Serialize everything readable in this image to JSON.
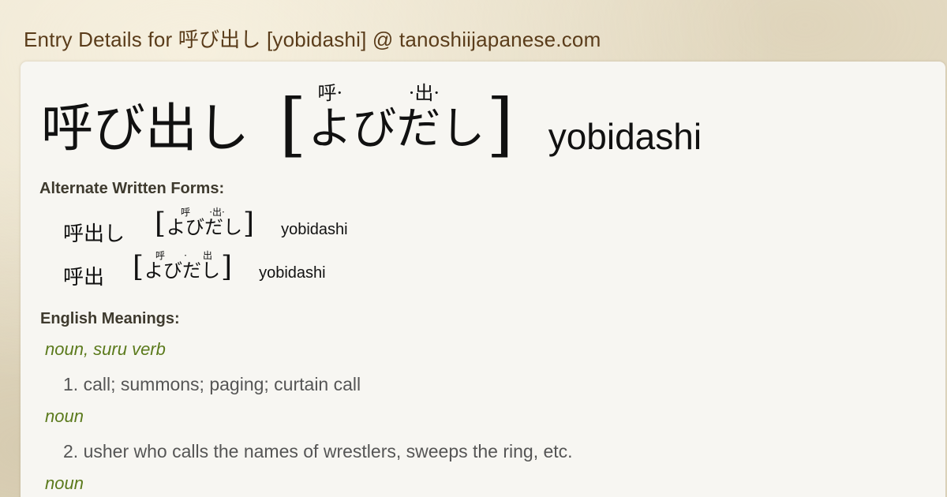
{
  "header": {
    "title": "Entry Details for 呼び出し [yobidashi] @ tanoshiijapanese.com"
  },
  "entry": {
    "kanji": "呼び出し",
    "bracket_open": "[",
    "bracket_close": "]",
    "ruby_top": [
      "呼·",
      "",
      "·出·",
      ""
    ],
    "reading": "よびだし",
    "romaji": "yobidashi"
  },
  "alternate_forms": {
    "heading": "Alternate Written Forms:",
    "items": [
      {
        "kanji": "呼出し",
        "ruby_top": [
          "呼",
          "·出·",
          ""
        ],
        "reading": "よびだし",
        "romaji": "yobidashi"
      },
      {
        "kanji": "呼出",
        "ruby_top": [
          "呼",
          "·",
          "出"
        ],
        "reading": "よびだし",
        "romaji": "yobidashi"
      }
    ]
  },
  "meanings": {
    "heading": "English Meanings:",
    "senses": [
      {
        "pos": "noun, suru verb",
        "text": "1. call; summons; paging; curtain call"
      },
      {
        "pos": "noun",
        "text": "2. usher who calls the names of wrestlers, sweeps the ring, etc."
      },
      {
        "pos": "noun",
        "text": ""
      }
    ]
  },
  "colors": {
    "header_text": "#5a3c1a",
    "pos_text": "#5b7a1c",
    "meaning_text": "#555555",
    "panel_bg": "#f7f6f2"
  }
}
